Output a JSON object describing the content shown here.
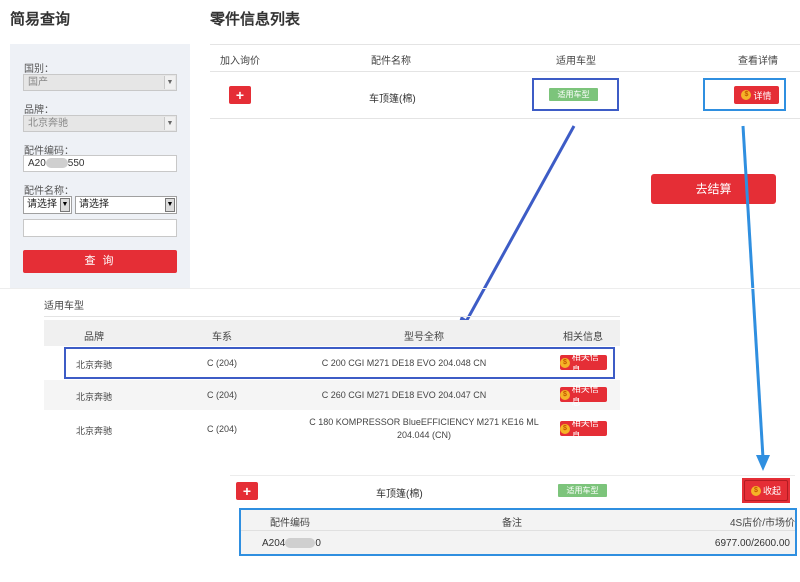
{
  "left": {
    "title": "简易查询",
    "country_label": "国别：",
    "country_value": "国产",
    "brand_label": "品牌：",
    "brand_value": "北京奔驰",
    "part_code_label": "配件编码：",
    "part_code_prefix": "A20",
    "part_code_suffix": "550",
    "part_name_label": "配件名称：",
    "select1": "请选择",
    "select2": "请选择",
    "query_button": "查 询"
  },
  "main": {
    "title": "零件信息列表",
    "headers": [
      "加入询价",
      "配件名称",
      "适用车型",
      "查看详情"
    ],
    "row": {
      "plus": "+",
      "part_name": "车顶篷(棉)",
      "badge": "适用车型",
      "detail_button": "详情"
    },
    "checkout_button": "去结算"
  },
  "vehicle_popup": {
    "title": "适用车型",
    "headers": [
      "品牌",
      "车系",
      "型号全称",
      "相关信息"
    ],
    "rows": [
      {
        "brand": "北京奔驰",
        "series": "C (204)",
        "model": "C 200 CGI M271 DE18 EVO 204.048 CN",
        "info": "相关信息"
      },
      {
        "brand": "北京奔驰",
        "series": "C (204)",
        "model": "C 260 CGI M271 DE18 EVO 204.047 CN",
        "info": "相关信息"
      },
      {
        "brand": "北京奔驰",
        "series": "C (204)",
        "model": "C 180 KOMPRESSOR BlueEFFICIENCY M271 KE16 ML 204.044 (CN)",
        "info": "相关信息"
      }
    ]
  },
  "bottom": {
    "plus": "+",
    "part_name": "车顶篷(棉)",
    "badge": "适用车型",
    "collapse_button": "收起",
    "detail_headers": [
      "配件编码",
      "备注",
      "4S店价/市场价"
    ],
    "detail_code_prefix": "A204",
    "detail_code_suffix": "0",
    "detail_price": "6977.00/2600.00"
  },
  "colors": {
    "accent_red": "#e52e36",
    "badge_green": "#7cc47b",
    "highlight_dark_blue": "#3d5cc6",
    "highlight_light_blue": "#2f8fe0",
    "panel_bg": "#eef1f6"
  }
}
